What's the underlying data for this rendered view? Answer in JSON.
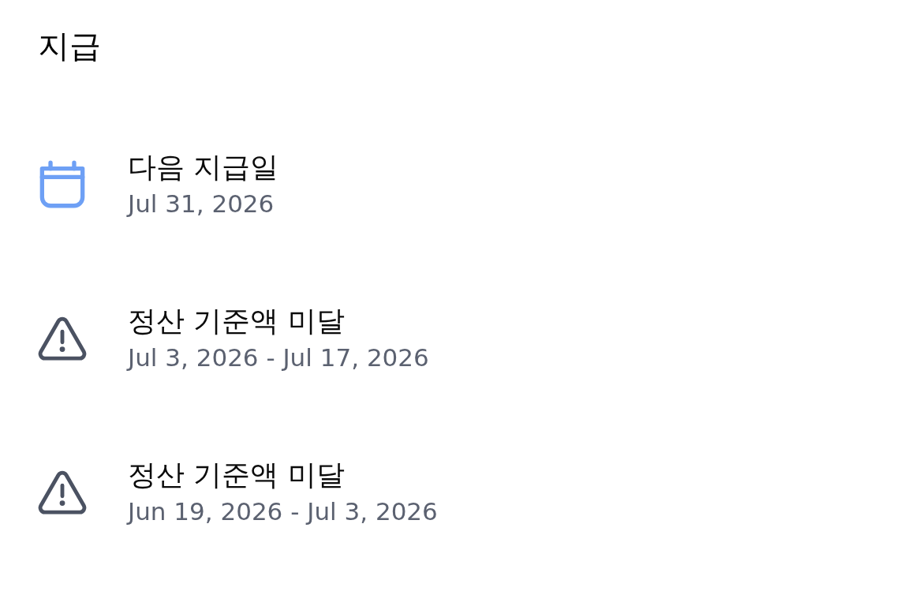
{
  "title": "지급",
  "items": [
    {
      "kind": "calendar",
      "label": "다음 지급일",
      "detail": "Jul 31, 2026"
    },
    {
      "kind": "warning",
      "label": "정산 기준액 미달",
      "detail": "Jul 3, 2026 - Jul 17, 2026"
    },
    {
      "kind": "warning",
      "label": "정산 기준액 미달",
      "detail": "Jun 19, 2026 - Jul 3, 2026"
    }
  ]
}
